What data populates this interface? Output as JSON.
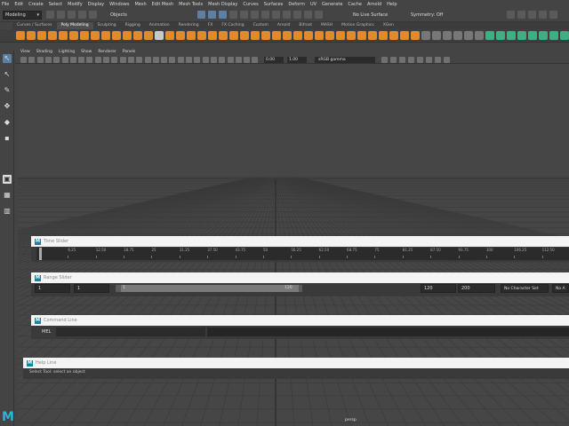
{
  "menubar": {
    "items": [
      "File",
      "Edit",
      "Create",
      "Select",
      "Modify",
      "Display",
      "Windows",
      "Mesh",
      "Edit Mesh",
      "Mesh Tools",
      "Mesh Display",
      "Curves",
      "Surfaces",
      "Deform",
      "UV",
      "Generate",
      "Cache",
      "Arnold",
      "Help"
    ]
  },
  "status": {
    "mode": "Modeling",
    "objects": "Objects",
    "live_surface": "No Live Surface",
    "symmetry": "Symmetry: Off"
  },
  "shelf": {
    "tabs": [
      "Curves / Surfaces",
      "Poly Modeling",
      "Sculpting",
      "Rigging",
      "Animation",
      "Rendering",
      "FX",
      "FX Caching",
      "Custom",
      "Arnold",
      "Bifrost",
      "MASH",
      "Motion Graphics",
      "XGen"
    ],
    "active_index": 1
  },
  "viewport": {
    "menu": [
      "View",
      "Shading",
      "Lighting",
      "Show",
      "Renderer",
      "Panels"
    ],
    "field1": "0.00",
    "field2": "1.00",
    "gamma": "sRGB gamma",
    "camera": "persp"
  },
  "time_slider": {
    "title": "Time Slider",
    "ticks": [
      "1",
      "6.25",
      "12.50",
      "18.75",
      "25",
      "31.25",
      "37.50",
      "43.75",
      "50",
      "56.25",
      "62.50",
      "68.75",
      "75",
      "81.25",
      "87.50",
      "93.75",
      "100",
      "106.25",
      "112.50",
      "118"
    ]
  },
  "range_slider": {
    "title": "Range Slider",
    "start": "1",
    "playback_start": "1",
    "slider_start": "1",
    "slider_end": "120",
    "playback_end": "120",
    "end": "200",
    "char_set": "No Character Set",
    "anim_layer": "No A"
  },
  "command_line": {
    "title": "Command Line",
    "lang": "MEL"
  },
  "help_line": {
    "title": "Help Line",
    "text": "Select Tool: select an object"
  },
  "colors": {
    "accent": "#5d7fa3",
    "shelf_orange": "#e08a2c",
    "shelf_green": "#3fae84",
    "logo": "#2bb5d8"
  }
}
